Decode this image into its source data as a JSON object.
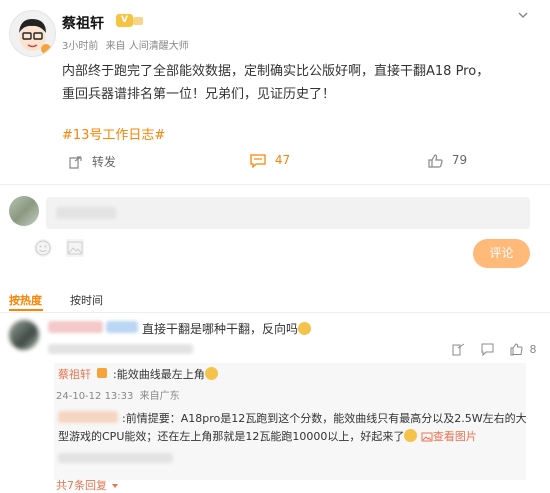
{
  "post": {
    "author": "蔡祖轩",
    "vip_badge": "V",
    "time": "3小时前",
    "source": "来自 人间清醒大师",
    "content": "内部终于跑完了全部能效数据，定制确实比公版好啊，直接干翻A18 Pro，重回兵器谱排名第一位！兄弟们，见证历史了！",
    "tag": "#13号工作日志#"
  },
  "actions": {
    "repost": "转发",
    "comment_count": "47",
    "like_count": "79"
  },
  "comment_box": {
    "submit_label": "评论"
  },
  "sort": {
    "hot": "按热度",
    "time": "按时间"
  },
  "comment1": {
    "text": "直接干翻是哪种干翻，反向吗",
    "like_count": "8"
  },
  "reply1": {
    "author": "蔡祖轩",
    "text": ":能效曲线最左上角",
    "time": "24-10-12 13:33",
    "location": "来自广东"
  },
  "reply2": {
    "text": ":前情提要：A18pro是12瓦跑到这个分数，能效曲线只有最高分以及2.5W左右的大型游戏的CPU能效；还在左上角那就是12瓦能跑10000以上，好起来了",
    "view_image": "查看图片"
  },
  "more_replies": "共7条回复",
  "colors": {
    "accent": "#ff8200",
    "link": "#eb7350",
    "button": "#ffb979"
  }
}
